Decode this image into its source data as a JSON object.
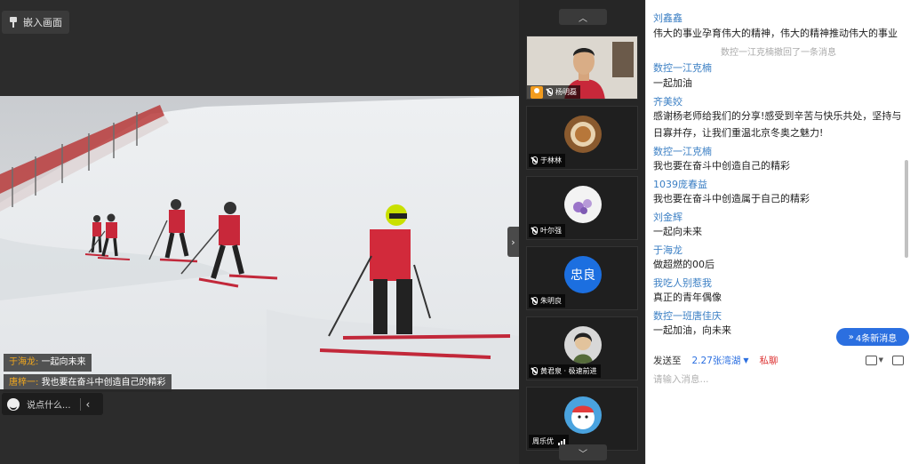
{
  "video": {
    "pin_label": "嵌入画面",
    "danmaku": [
      {
        "nick": "于海龙:",
        "text": "一起向未来"
      },
      {
        "nick": "唐梓一:",
        "text": "我也要在奋斗中创造自己的精彩"
      }
    ],
    "chat_input_placeholder": "说点什么..."
  },
  "participants": {
    "scroll_up": "︿",
    "scroll_down": "﹀",
    "tiles": [
      {
        "label": "杨明磊",
        "type": "camera"
      },
      {
        "label": "于林林",
        "type": "avatar"
      },
      {
        "label": "叶尔强",
        "type": "avatar"
      },
      {
        "label": "朱明良",
        "type": "text-avatar",
        "avatar_text": "忠良"
      },
      {
        "label": "黄君泉 · 极速前进",
        "type": "avatar"
      },
      {
        "label": "周乐优",
        "type": "avatar"
      }
    ]
  },
  "chat": {
    "messages": [
      {
        "name": "刘鑫鑫",
        "text": "伟大的事业孕育伟大的精神，伟大的精神推动伟大的事业"
      },
      {
        "system": "数控一江克楠撤回了一条消息"
      },
      {
        "name": "数控一江克楠",
        "text": "一起加油"
      },
      {
        "name": "齐美姣",
        "text": "感谢杨老师给我们的分享!感受到辛苦与快乐共处，坚持与日寡并存，让我们重温北京冬奥之魅力!"
      },
      {
        "name": "数控一江克楠",
        "text": "我也要在奋斗中创造自己的精彩"
      },
      {
        "name": "1039庞春益",
        "text": "我也要在奋斗中创造属于自己的精彩"
      },
      {
        "name": "刘金辉",
        "text": "一起向未来"
      },
      {
        "name": "于海龙",
        "text": "做超燃的00后"
      },
      {
        "name": "我吃人别惹我",
        "text": "真正的青年偶像"
      },
      {
        "name": "数控一班唐佳庆",
        "text": "一起加油，向未来"
      }
    ],
    "new_messages_label": "4条新消息",
    "send_to_label": "发送至",
    "send_target": "2.27张湾湖",
    "private_label": "私聊",
    "input_placeholder": "请输入消息..."
  }
}
